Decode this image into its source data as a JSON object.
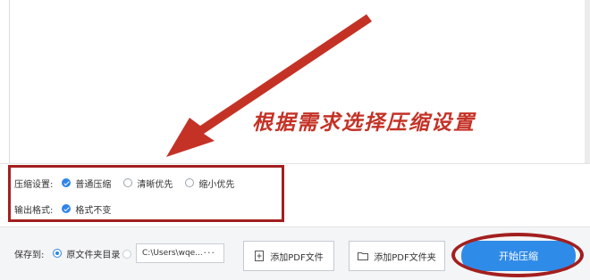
{
  "annotation": {
    "text": "根据需求选择压缩设置",
    "color": "#c43226"
  },
  "compression": {
    "label": "压缩设置:",
    "options": [
      {
        "label": "普通压缩",
        "checked": true
      },
      {
        "label": "清晰优先",
        "checked": false
      },
      {
        "label": "缩小优先",
        "checked": false
      }
    ]
  },
  "output_format": {
    "label": "输出格式:",
    "option": {
      "label": "格式不变",
      "checked": true
    }
  },
  "save_to": {
    "label": "保存到:",
    "option_label": "原文件夹目录",
    "path_value": "C:\\Users\\wqe...",
    "more": "···"
  },
  "buttons": {
    "add_pdf_file": "添加PDF文件",
    "add_pdf_folder": "添加PDF文件夹",
    "start_compress": "开始压缩"
  },
  "colors": {
    "accent": "#2f8be8",
    "highlight": "#a31f1f"
  }
}
